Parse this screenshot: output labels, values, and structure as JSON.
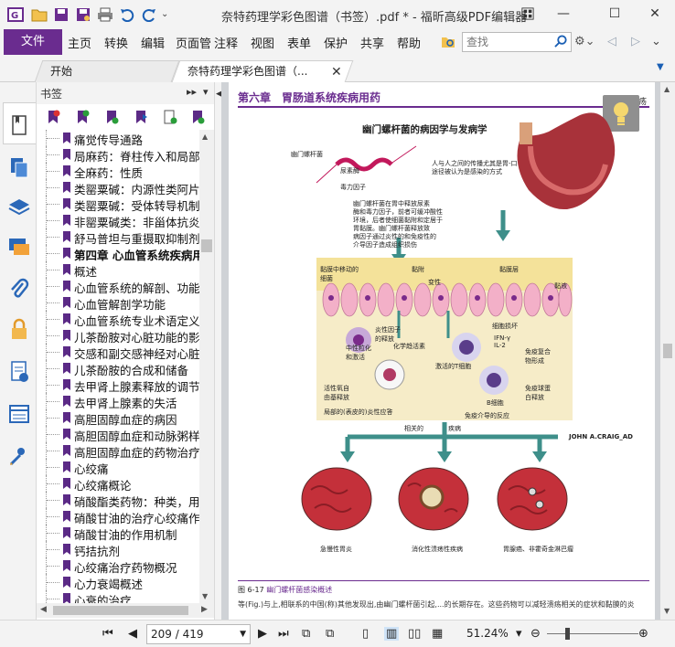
{
  "window": {
    "title": "奈特药理学彩色图谱（书签）.pdf * - 福昕高级PDF编辑器",
    "minimize_glyph": "—",
    "maximize_glyph": "☐",
    "close_glyph": "✕"
  },
  "quick_access": {
    "icons": [
      "app-logo-icon",
      "open-folder-icon",
      "save-icon",
      "save-as-icon",
      "print-icon",
      "undo-icon",
      "redo-icon",
      "customize-dropdown-icon"
    ]
  },
  "ribbon": {
    "file_label": "文件",
    "menus": [
      "主页",
      "转换",
      "编辑",
      "页面管理",
      "注释",
      "视图",
      "表单",
      "保护",
      "共享",
      "帮助"
    ],
    "search_placeholder": "查找"
  },
  "tabs": {
    "home_label": "开始",
    "doc_label": "奈特药理学彩色图谱（..."
  },
  "bookmarks": {
    "header": "书签",
    "items": [
      {
        "label": "痛觉传导通路",
        "bold": false
      },
      {
        "label": "局麻药：脊柱传入和局部麻",
        "bold": false
      },
      {
        "label": "全麻药：性质",
        "bold": false
      },
      {
        "label": "类罂粟碱：内源性类阿片样",
        "bold": false
      },
      {
        "label": "类罂粟碱：受体转导机制",
        "bold": false
      },
      {
        "label": "非罂粟碱类：非甾体抗炎药",
        "bold": false
      },
      {
        "label": "舒马普坦与重摄取抑制剂",
        "bold": false
      },
      {
        "label": "第四章  心血管系统疾病用",
        "bold": true
      },
      {
        "label": "概述",
        "bold": false
      },
      {
        "label": "心血管系统的解剖、功能和",
        "bold": false
      },
      {
        "label": "心血管解剖学功能",
        "bold": false
      },
      {
        "label": "心血管系统专业术语定义",
        "bold": false
      },
      {
        "label": "儿茶酚胺对心脏功能的影响",
        "bold": false
      },
      {
        "label": "交感和副交感神经对心脏功",
        "bold": false
      },
      {
        "label": "儿茶酚胺的合成和储备",
        "bold": false
      },
      {
        "label": "去甲肾上腺素释放的调节",
        "bold": false
      },
      {
        "label": "去甲肾上腺素的失活",
        "bold": false
      },
      {
        "label": "高胆固醇血症的病因",
        "bold": false
      },
      {
        "label": "高胆固醇血症和动脉粥样硬",
        "bold": false
      },
      {
        "label": "高胆固醇血症的药物治疗",
        "bold": false
      },
      {
        "label": "心绞痛",
        "bold": false
      },
      {
        "label": "心绞痛概论",
        "bold": false
      },
      {
        "label": "硝酸酯类药物：种类，用途",
        "bold": false
      },
      {
        "label": "硝酸甘油的治疗心绞痛作用",
        "bold": false
      },
      {
        "label": "硝酸甘油的作用机制",
        "bold": false
      },
      {
        "label": "钙拮抗剂",
        "bold": false
      },
      {
        "label": "心绞痛治疗药物概况",
        "bold": false
      },
      {
        "label": "心力衰竭概述",
        "bold": false
      },
      {
        "label": "心衰的治疗",
        "bold": false
      }
    ]
  },
  "document": {
    "chapter_header": "第六章　胃肠道系统疾病用药",
    "header_right": "消化性溃疡",
    "figure_title": "幽门螺杆菌的病因学与发病学",
    "labels": {
      "bacterium": "幽门螺杆菌",
      "urease": "尿素酶",
      "toxin": "毒力因子",
      "transmission_1": "人与人之间的传播尤其是胃-口",
      "transmission_2": "途径被认为是感染的方式",
      "desc_1": "幽门螺杆菌在胃中释放尿素",
      "desc_2": "酶和毒力因子，前者可缓冲酸性",
      "desc_3": "环境，后者使细菌黏附和定居于",
      "desc_4": "胃黏膜。幽门螺杆菌释放致",
      "desc_5": "病因子通过炎性的和免疫性的",
      "desc_6": "介导因子造成组织损伤",
      "mucosa": "黏膜层",
      "mucus": "黏液",
      "attach": "黏附",
      "cell_damage": "黏膜中移动的细菌",
      "degeneration": "变性",
      "infiltration": "细胞损坏",
      "inflammatory": "炎性因子的释放",
      "neutrophil": "中性粒化和激活",
      "chemical": "化学趋活素",
      "t_cell": "激活的T细胞",
      "b_cell": "B细胞",
      "ifn": "IFN-γ IL-2",
      "immune_complex": "免疫复合物形成",
      "antibody": "免疫球蛋白释放",
      "oxygen": "活性氧自由基释放",
      "local": "局部的(表皮的)炎性应答",
      "immune_response": "免疫介导的反应",
      "related": "相关的",
      "disease": "疾病",
      "gastritis": "急慢性胃炎",
      "ulcer": "消化性溃疡性疾病",
      "lymphoma": "胃腺癌、非霍奇金淋巴瘤",
      "signature": "JOHN A.CRAIG_AD"
    },
    "caption_number": "图 6-17",
    "caption_text": "幽门螺杆菌感染概述",
    "body_line": "等(Fig.)与上,相联系的中国(称)其他发现出,由幽门螺杆菌引起,...的长期存在。这些药物可以减轻溃疡相关的症状和黏膜的炎"
  },
  "statusbar": {
    "page_value": "209 / 419",
    "zoom_value": "51.24%"
  },
  "colors": {
    "accent": "#6a2c8f",
    "nav_icon_blue": "#2b68b8",
    "bookmark_purple": "#5b2a86"
  }
}
